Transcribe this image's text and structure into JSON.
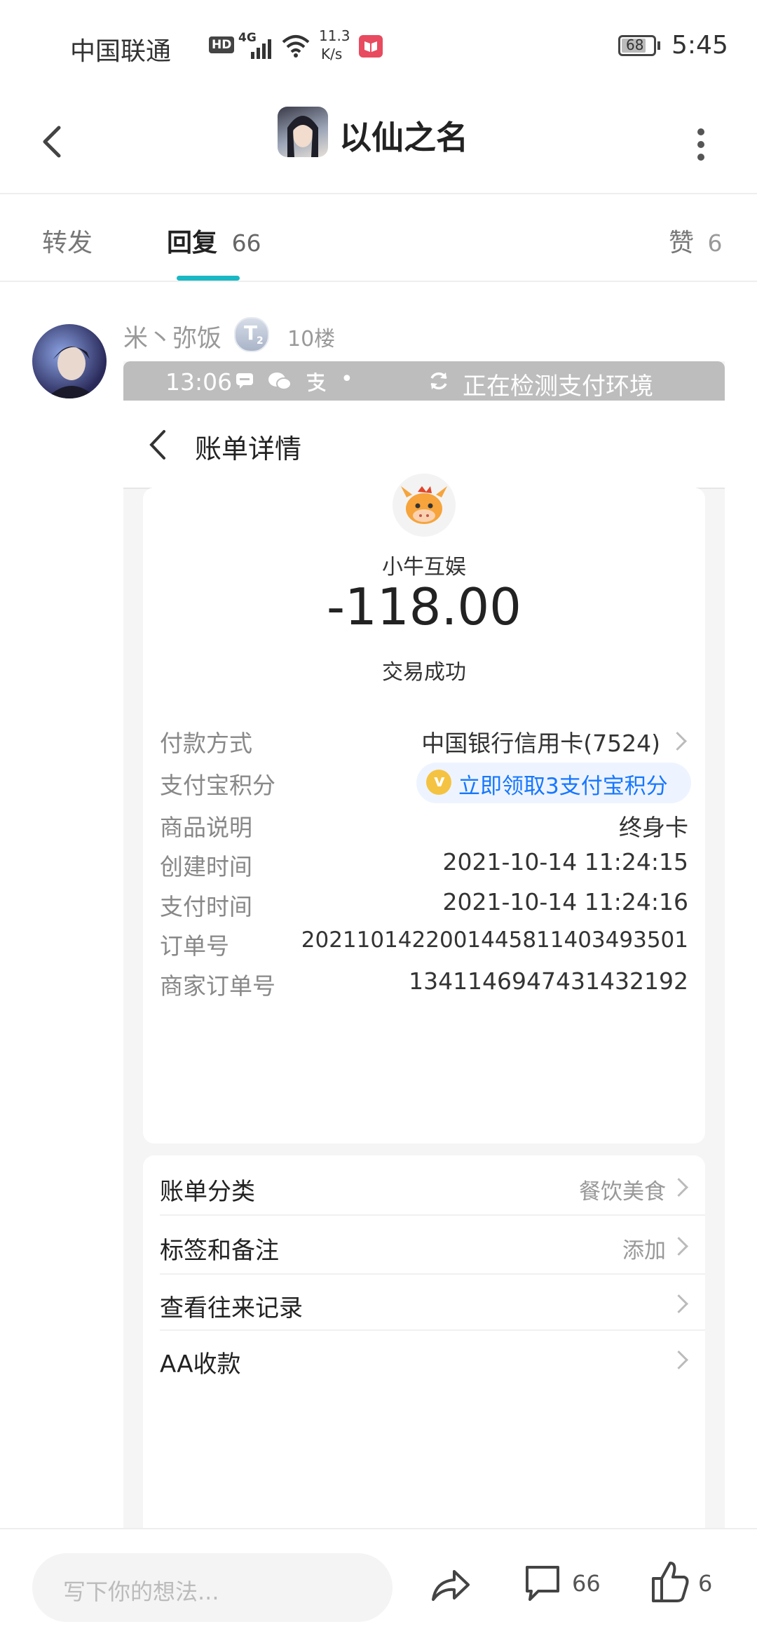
{
  "status_bar": {
    "carrier": "中国联通",
    "hd": "HD",
    "network": "4G",
    "speed_value": "11.3",
    "speed_unit": "K/s",
    "battery": "68",
    "time": "5:45"
  },
  "header": {
    "title": "以仙之名"
  },
  "tabs": [
    {
      "label": "转发",
      "count": ""
    },
    {
      "label": "回复",
      "count": "66"
    },
    {
      "label": "赞",
      "count": "6"
    }
  ],
  "reply": {
    "username": "米丶弥饭",
    "badge": "T",
    "badge_sub": "2",
    "floor": "10楼"
  },
  "screenshot": {
    "inner_status": {
      "time": "13:06",
      "dot": "•",
      "checking_text": "正在检测支付环境"
    },
    "nav_title": "账单详情",
    "merchant": "小牛互娱",
    "amount": "-118.00",
    "status": "交易成功",
    "details": [
      {
        "label": "付款方式",
        "value": "中国银行信用卡(7524)"
      },
      {
        "label": "支付宝积分",
        "value": "立即领取3支付宝积分"
      },
      {
        "label": "商品说明",
        "value": "终身卡"
      },
      {
        "label": "创建时间",
        "value": "2021-10-14 11:24:15"
      },
      {
        "label": "支付时间",
        "value": "2021-10-14 11:24:16"
      },
      {
        "label": "订单号",
        "value": "2021101422001445811403493501"
      },
      {
        "label": "商家订单号",
        "value": "1341146947431432192"
      }
    ],
    "points_badge": "v",
    "list": [
      {
        "label": "账单分类",
        "value": "餐饮美食"
      },
      {
        "label": "标签和备注",
        "value": "添加"
      },
      {
        "label": "查看往来记录",
        "value": ""
      },
      {
        "label": "AA收款",
        "value": ""
      }
    ]
  },
  "bottom_bar": {
    "input_placeholder": "写下你的想法...",
    "comment_count": "66",
    "like_count": "6"
  },
  "colors": {
    "accent": "#1ab8c4",
    "link_blue": "#1677ff",
    "points_bg": "#eef4ff",
    "inner_status_bg": "#bdbdbd",
    "coin_gold": "#f5c342"
  }
}
